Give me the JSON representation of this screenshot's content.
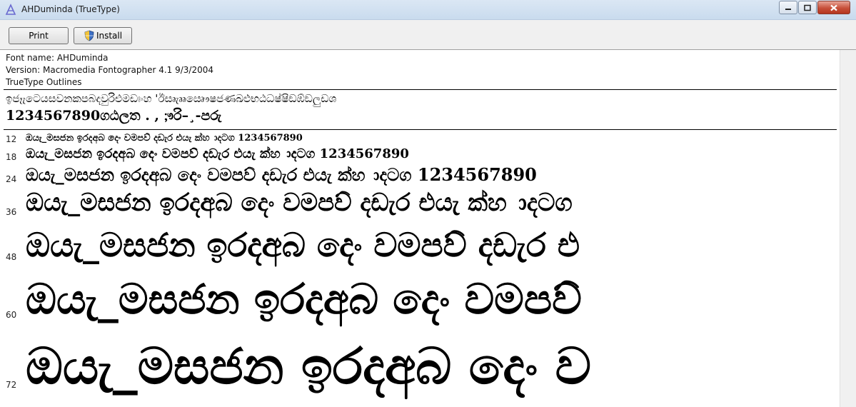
{
  "window": {
    "title": "AHDuminda (TrueType)",
    "icon": "font-file-icon"
  },
  "toolbar": {
    "print_label": "Print",
    "install_label": "Install"
  },
  "info": {
    "font_name": "Font name: AHDuminda",
    "version": "Version: Macromedia Fontographer 4.1 9/3/2004",
    "outlines": "TrueType Outlines"
  },
  "charset": {
    "line1": "ඉජෑැටෙයසවනකපබදවුරිඑමඩඃංහ 'ඊසෘැෲඍෞෂජණඛඵභඨධෂ්ෂිඞඹ්ඞලුඩශ",
    "line2": "1234567890ගඨලත . , ;ෟරි–¸-පරු"
  },
  "samples": [
    {
      "size": "12",
      "text": "ඔයැ_මසජන ඉරදඅබ දෙං වමපව් දඩැර එයැ ක්හ ාදටග 1234567890"
    },
    {
      "size": "18",
      "text": "ඔයැ_මසජන ඉරදඅබ දෙං වමපව් දඩැර එයැ ක්හ ාදටග 1234567890"
    },
    {
      "size": "24",
      "text": "ඔයැ_මසජන ඉරදඅබ දෙං වමපව් දඩැර එයැ ක්හ ාදටග 1234567890"
    },
    {
      "size": "36",
      "text": "ඔයැ_මසජන ඉරදඅබ දෙං වමපව් දඩැර එයැ ක්හ ාදටග"
    },
    {
      "size": "48",
      "text": "ඔයැ_මසජන ඉරදඅබ දෙං වමපව් දඩැර එ"
    },
    {
      "size": "60",
      "text": "ඔයැ_මසජන ඉරදඅබ දෙං වමපව්"
    },
    {
      "size": "72",
      "text": "ඔයැ_මසජන ඉරදඅබ දෙං ව"
    }
  ]
}
